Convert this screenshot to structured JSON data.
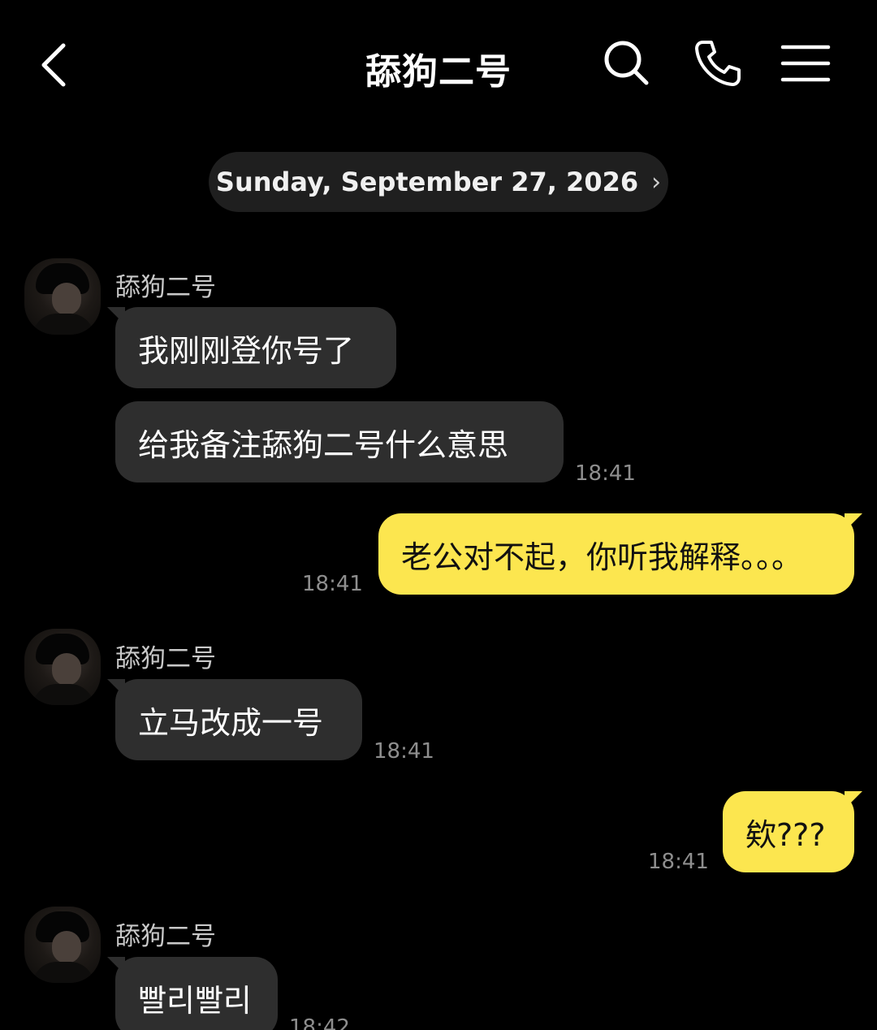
{
  "header": {
    "title": "舔狗二号",
    "back_icon": "chevron-left-icon",
    "search_icon": "search-icon",
    "call_icon": "phone-icon",
    "menu_icon": "hamburger-menu-icon"
  },
  "date_pill": {
    "label": "Sunday, September 27, 2026",
    "chevron": "›"
  },
  "colors": {
    "background": "#000000",
    "incoming_bubble": "#2e2e2e",
    "outgoing_bubble": "#fce64f",
    "timestamp": "#8e8e8e"
  },
  "messages": [
    {
      "direction": "in",
      "sender": "舔狗二号",
      "text": "我刚刚登你号了"
    },
    {
      "direction": "in",
      "text": "给我备注舔狗二号什么意思",
      "time": "18:41"
    },
    {
      "direction": "out",
      "text": "老公对不起，你听我解释。。。",
      "time": "18:41"
    },
    {
      "direction": "in",
      "sender": "舔狗二号",
      "text": "立马改成一号",
      "time": "18:41"
    },
    {
      "direction": "out",
      "text": "欸???",
      "time": "18:41"
    },
    {
      "direction": "in",
      "sender": "舔狗二号",
      "text": "빨리빨리",
      "time": "18:42"
    }
  ]
}
